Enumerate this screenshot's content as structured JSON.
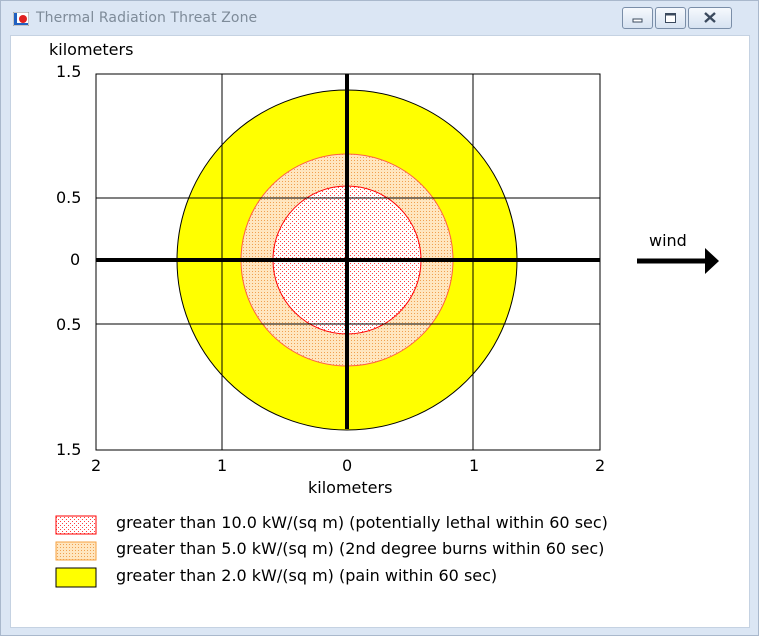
{
  "window": {
    "title": "Thermal Radiation Threat Zone",
    "controls": [
      "minimize",
      "maximize",
      "close"
    ]
  },
  "plot": {
    "y_unit_label": "kilometers",
    "x_unit_label": "kilometers",
    "y_tick_labels": [
      "1.5",
      "0.5",
      "0",
      "0.5",
      "1.5"
    ],
    "x_tick_labels": [
      "2",
      "1",
      "0",
      "1",
      "2"
    ],
    "wind_label": "wind"
  },
  "legend": [
    {
      "label": "greater than 10.0 kW/(sq m) (potentially lethal within 60 sec)",
      "color": "#ff0000",
      "fill": "dotted-red"
    },
    {
      "label": "greater than 5.0 kW/(sq m) (2nd degree burns within 60 sec)",
      "color": "#f5a623",
      "fill": "dotted-orange"
    },
    {
      "label": "greater than 2.0 kW/(sq m) (pain within 60 sec)",
      "color": "#ffff00",
      "fill": "solid-yellow"
    }
  ],
  "colors": {
    "lethal": "#ff0000",
    "burns": "#ffa64d",
    "pain": "#ffff00"
  },
  "chart_data": {
    "type": "threat-zone-circles",
    "x_range": [
      -2,
      2
    ],
    "y_range": [
      -1.5,
      1.5
    ],
    "zones_radius_km": [
      0.59,
      0.85,
      1.35
    ],
    "grid": true
  }
}
